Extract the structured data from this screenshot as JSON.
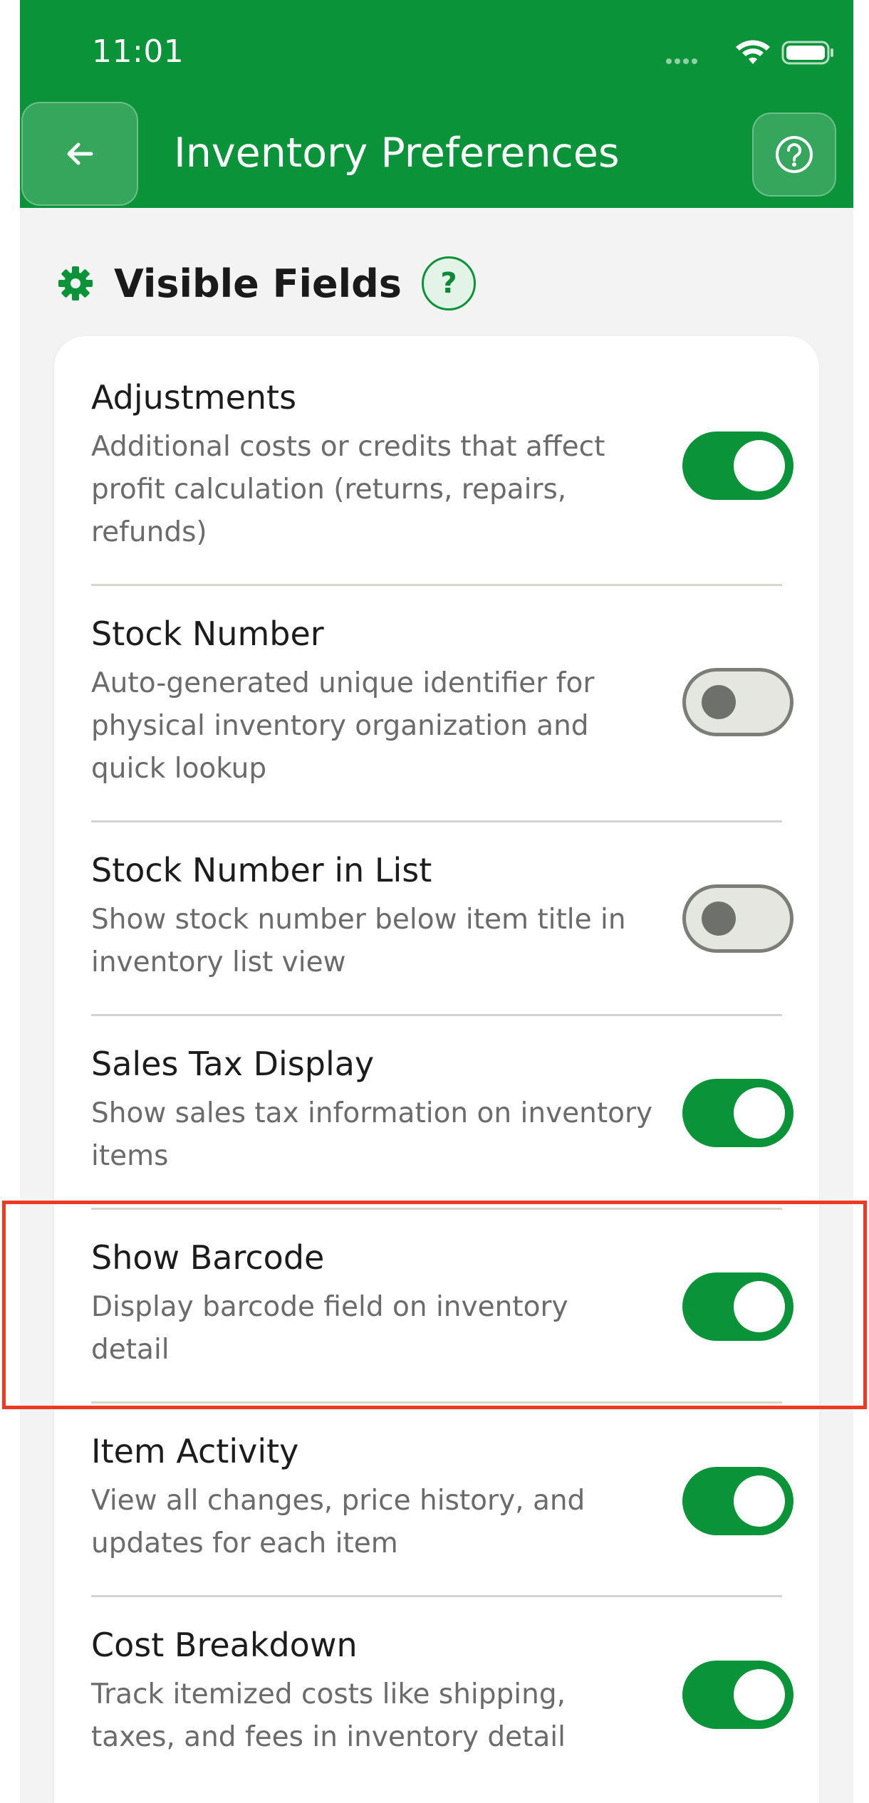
{
  "status": {
    "time": "11:01"
  },
  "header": {
    "title": "Inventory Preferences"
  },
  "section": {
    "title": "Visible Fields",
    "help": "?"
  },
  "fields": [
    {
      "title": "Adjustments",
      "desc": "Additional costs or credits that affect profit calculation (returns, repairs, refunds)",
      "enabled": true
    },
    {
      "title": "Stock Number",
      "desc": "Auto-generated unique identifier for physical inventory organization and quick lookup",
      "enabled": false
    },
    {
      "title": "Stock Number in List",
      "desc": "Show stock number below item title in inventory list view",
      "enabled": false
    },
    {
      "title": "Sales Tax Display",
      "desc": "Show sales tax information on inventory items",
      "enabled": true
    },
    {
      "title": "Show Barcode",
      "desc": "Display barcode field on inventory detail",
      "enabled": true
    },
    {
      "title": "Item Activity",
      "desc": "View all changes, price history, and updates for each item",
      "enabled": true
    },
    {
      "title": "Cost Breakdown",
      "desc": "Track itemized costs like shipping, taxes, and fees in inventory detail",
      "enabled": true
    }
  ],
  "colors": {
    "primary": "#0a9339",
    "toggle_off": "#e5e6df",
    "highlight": "#ee3a25"
  },
  "highlighted_field": "Show Barcode"
}
